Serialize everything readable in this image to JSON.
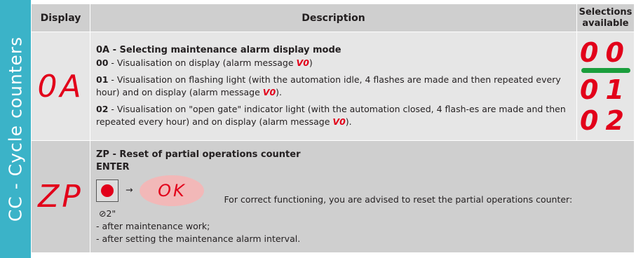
{
  "side_title": "CC - Cycle counters",
  "headers": {
    "display": "Display",
    "description": "Description",
    "selections": "Selections available"
  },
  "row1": {
    "display": "0A",
    "title": "0A - Selecting maintenance alarm display mode",
    "opt00_code": "00",
    "opt00_text": " - Visualisation on display (alarm message ",
    "opt01_code": "01",
    "opt01_text": " - Visualisation on flashing light (with the automation idle, 4 flashes are made and then repeated every hour) and on display (alarm message ",
    "opt02_code": "02",
    "opt02_text": " - Visualisation on \"open gate\" indicator light (with the automation closed, 4 flash-es are made and then repeated every hour) and on display (alarm message ",
    "alarm_msg": "V0",
    "selections": [
      "00",
      "01",
      "02"
    ]
  },
  "row2": {
    "display": "ZP",
    "title": "ZP - Reset of partial operations counter",
    "enter": "ENTER",
    "ok": "OK",
    "time": "⊘2\"",
    "note": "For correct functioning, you are advised to reset the partial operations counter:",
    "items": [
      "- after maintenance work;",
      "- after setting the maintenance alarm interval."
    ]
  }
}
